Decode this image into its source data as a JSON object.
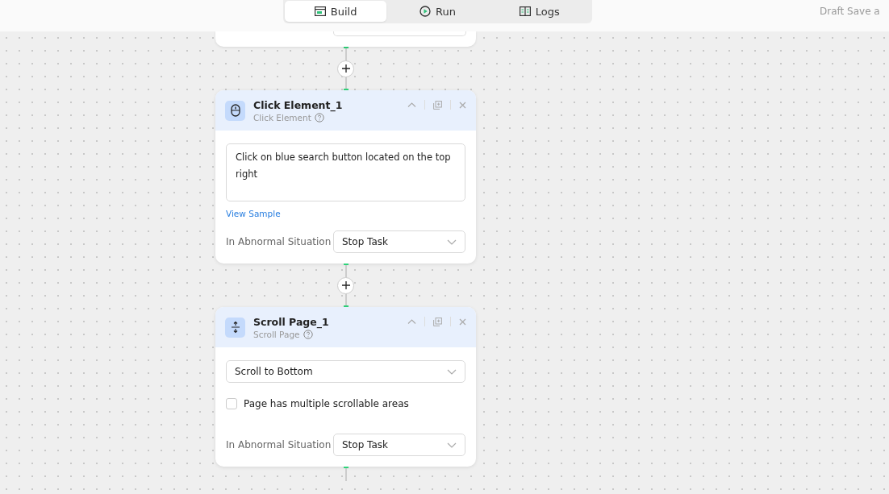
{
  "tabs": [
    {
      "label": "Build",
      "selected": true
    },
    {
      "label": "Run",
      "selected": false
    },
    {
      "label": "Logs",
      "selected": false
    }
  ],
  "draft_status": "Draft Save a",
  "nodes": [
    {
      "kind": "click",
      "title": "Click Element_1",
      "subtitle": "Click Element",
      "description": "Click on blue search button located on the top right",
      "link": "View Sample",
      "abnormal_label": "In Abnormal Situation",
      "abnormal_value": "Stop Task"
    },
    {
      "kind": "scroll",
      "title": "Scroll Page_1",
      "subtitle": "Scroll Page",
      "mode": "Scroll to Bottom",
      "checkbox": {
        "label": "Page has multiple scrollable areas",
        "checked": false
      },
      "abnormal_label": "In Abnormal Situation",
      "abnormal_value": "Stop Task"
    }
  ]
}
